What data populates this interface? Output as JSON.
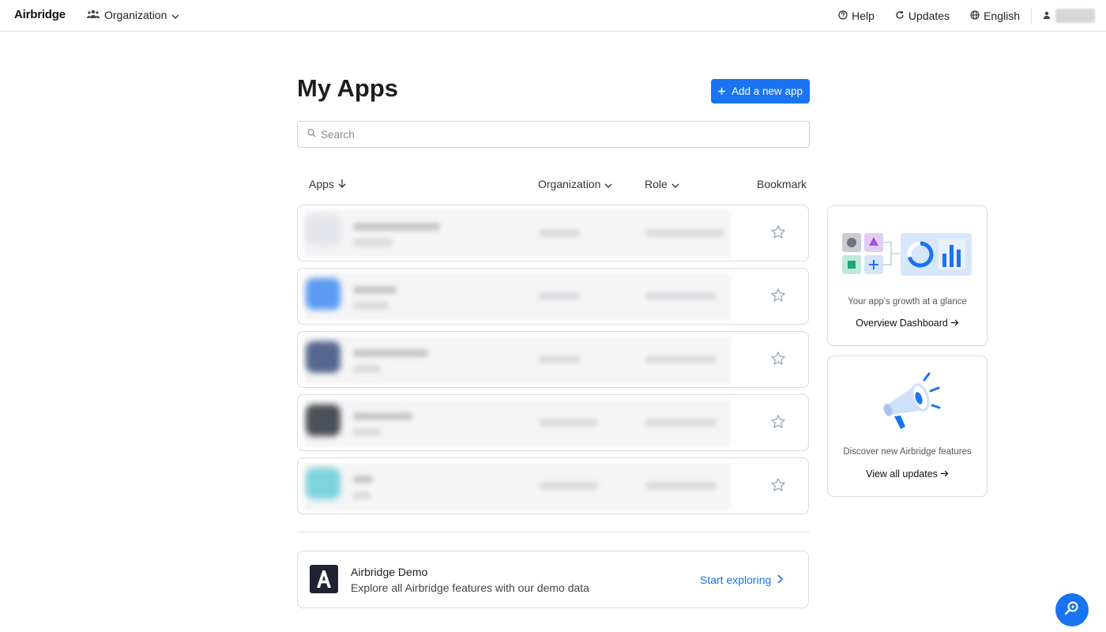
{
  "nav": {
    "logo": "Airbridge",
    "org_switch": "Organization",
    "help": "Help",
    "updates": "Updates",
    "language": "English"
  },
  "main": {
    "title": "My Apps",
    "add_button": "Add a new app",
    "search_placeholder": "Search",
    "columns": {
      "apps": "Apps",
      "organization": "Organization",
      "role": "Role",
      "bookmark": "Bookmark"
    },
    "rows_count_note": ""
  },
  "demo": {
    "title": "Airbridge Demo",
    "subtitle": "Explore all Airbridge features with our demo data",
    "link": "Start exploring"
  },
  "side": {
    "dashboard_desc": "Your app's growth at a glance",
    "dashboard_link": "Overview Dashboard",
    "updates_desc": "Discover new Airbridge features",
    "updates_link": "View all updates"
  },
  "colors": {
    "accent": "#1a73f0",
    "border": "#d9dbdf"
  }
}
